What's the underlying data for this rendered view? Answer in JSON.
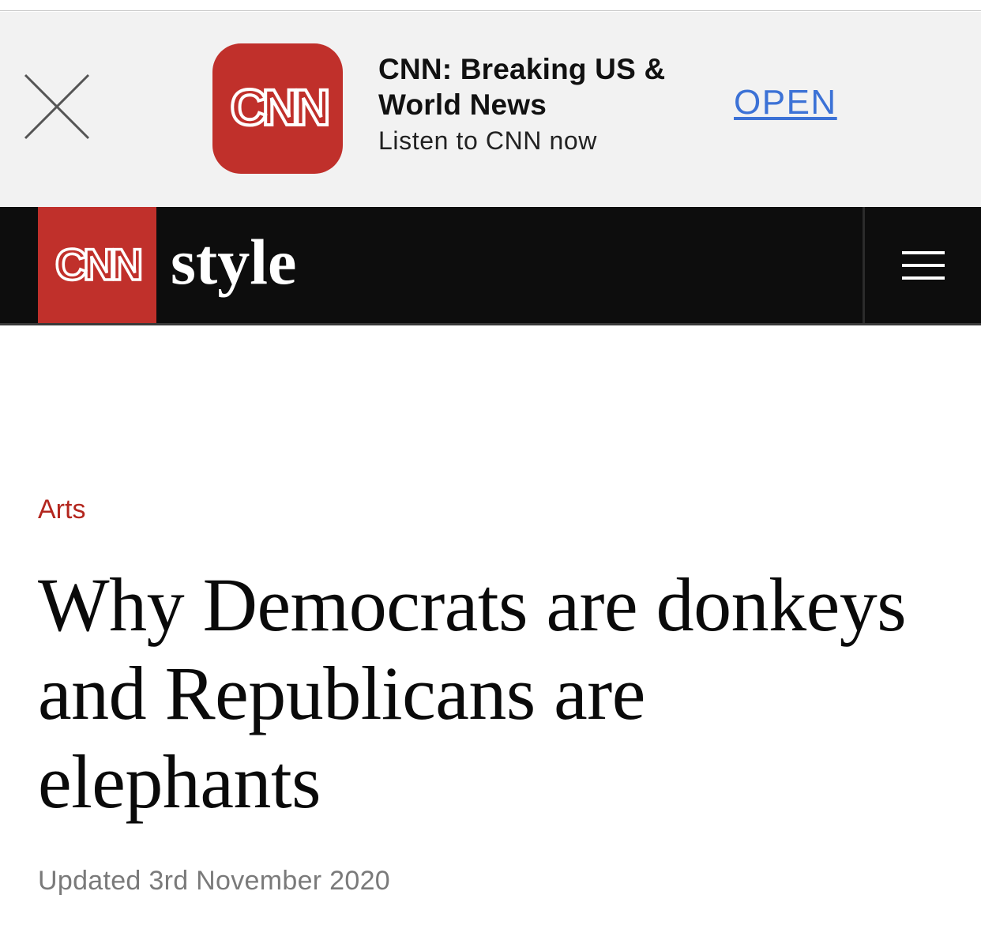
{
  "app_banner": {
    "close_icon": "close-x-icon",
    "app_icon": "cnn-logo-icon",
    "app_icon_text": "CNN",
    "app_name": "CNN: Breaking US & World News",
    "subtitle": "Listen to CNN now",
    "open_label": "OPEN",
    "colors": {
      "background": "#f2f2f2",
      "icon_red": "#c0302b",
      "open_link": "#3c72d6"
    }
  },
  "navbar": {
    "logo_text": "CNN",
    "section_name": "style",
    "menu_icon": "hamburger-menu-icon",
    "colors": {
      "background": "#0d0d0d",
      "logo_red": "#c0302b"
    }
  },
  "article": {
    "category": "Arts",
    "headline": "Why Democrats are donkeys and Republicans are elephants",
    "updated": "Updated 3rd November 2020",
    "colors": {
      "category": "#b3261e",
      "updated": "#7a7a7a"
    }
  }
}
